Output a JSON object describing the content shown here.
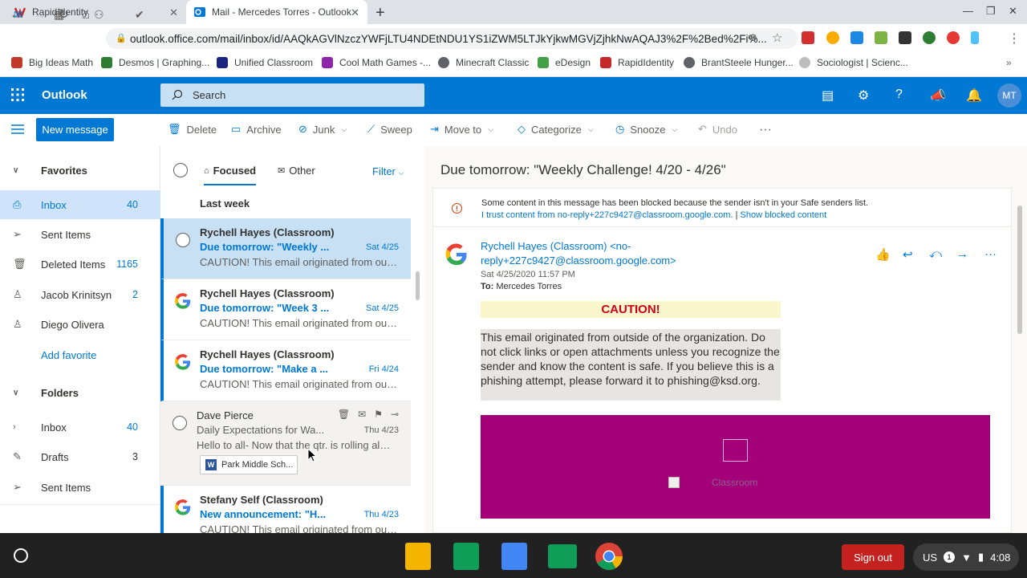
{
  "browser": {
    "tabs": [
      {
        "title": "RapidIdentity",
        "active": false
      },
      {
        "title": "Mail - Mercedes Torres - Outlook",
        "active": true
      }
    ],
    "url": "outlook.office.com/mail/inbox/id/AAQkAGVlNzczYWFjLTU4NDEtNDU1YS1iZWM5LTJkYjkwMGVjZjhkNwAQAJ3%2F%2Bed%2Fi%...",
    "bookmarks": [
      "Big Ideas Math",
      "Desmos | Graphing...",
      "Unified Classroom",
      "Cool Math Games -...",
      "Minecraft Classic",
      "eDesign",
      "RapidIdentity",
      "BrantSteele Hunger...",
      "Sociologist | Scienc..."
    ]
  },
  "outlook": {
    "app_name": "Outlook",
    "search_placeholder": "Search",
    "avatar_initials": "MT",
    "new_message": "New message",
    "commands": {
      "delete": "Delete",
      "archive": "Archive",
      "junk": "Junk",
      "sweep": "Sweep",
      "move_to": "Move to",
      "categorize": "Categorize",
      "snooze": "Snooze",
      "undo": "Undo"
    }
  },
  "nav": {
    "favorites_label": "Favorites",
    "favorites": [
      {
        "label": "Inbox",
        "count": "40",
        "selected": true
      },
      {
        "label": "Sent Items",
        "count": ""
      },
      {
        "label": "Deleted Items",
        "count": "1165"
      },
      {
        "label": "Jacob Krinitsyn",
        "count": "2"
      },
      {
        "label": "Diego Olivera",
        "count": ""
      }
    ],
    "add_favorite": "Add favorite",
    "folders_label": "Folders",
    "folders": [
      {
        "label": "Inbox",
        "count": "40"
      },
      {
        "label": "Drafts",
        "count": "3"
      },
      {
        "label": "Sent Items",
        "count": ""
      }
    ]
  },
  "list": {
    "focused": "Focused",
    "other": "Other",
    "filter": "Filter",
    "group": "Last week",
    "messages": [
      {
        "sender": "Rychell Hayes (Classroom)",
        "subject": "Due tomorrow: \"Weekly ...",
        "date": "Sat 4/25",
        "preview": "CAUTION! This email originated from outside of the organization."
      },
      {
        "sender": "Rychell Hayes (Classroom)",
        "subject": "Due tomorrow: \"Week 3 ...",
        "date": "Sat 4/25",
        "preview": "CAUTION! This email originated from outside of the organization."
      },
      {
        "sender": "Rychell Hayes (Classroom)",
        "subject": "Due tomorrow: \"Make a ...",
        "date": "Fri 4/24",
        "preview": "CAUTION! This email originated from outside of the organization."
      },
      {
        "sender": "Dave Pierce",
        "subject": "Daily Expectations for Wa...",
        "date": "Thu 4/23",
        "preview": "Hello to all- Now that the qtr. is rolling along",
        "attachment": "Park Middle Sch..."
      },
      {
        "sender": "Stefany Self (Classroom)",
        "subject": "New announcement: \"H...",
        "date": "Thu 4/23",
        "preview": "CAUTION! This email originated from outside of the organization."
      }
    ]
  },
  "reading": {
    "subject": "Due tomorrow: \"Weekly Challenge! 4/20 - 4/26\"",
    "blocked_notice": "Some content in this message has been blocked because the sender isn't in your Safe senders list.",
    "trust_link": "I trust content from no-reply+227c9427@classroom.google.com.",
    "separator": "|",
    "show_blocked": "Show blocked content",
    "from": "Rychell Hayes (Classroom) <no-reply+227c9427@classroom.google.com>",
    "sent": "Sat 4/25/2020 11:57 PM",
    "to_label": "To:",
    "to": "Mercedes Torres",
    "caution": "CAUTION!",
    "warning": "This email originated from outside of the organization. Do not click links or open attachments unless you recognize the sender and know the content is safe. If you believe this is a phishing attempt, please forward it to phishing@ksd.org.",
    "banner_alt": "Classroom",
    "banner_color": "#a4007a"
  },
  "shelf": {
    "sign_out": "Sign out",
    "locale": "US",
    "notifications": "1",
    "time": "4:08"
  },
  "colors": {
    "accent": "#0078d4",
    "selected_row": "#c7e0f4",
    "caution_red": "#d0021b"
  }
}
